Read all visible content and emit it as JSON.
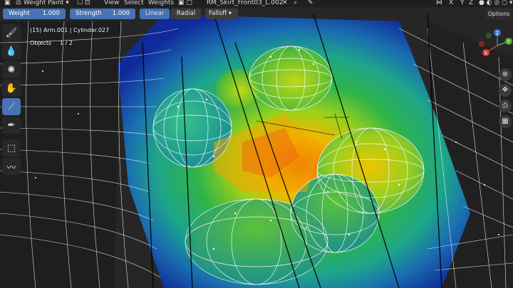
{
  "header": {
    "mode": "Weight Paint",
    "menu_view": "View",
    "menu_select": "Select",
    "menu_weights": "Weights",
    "object_name": "RM_Skirt_Front03_L.002"
  },
  "tool_settings": {
    "weight_label": "Weight",
    "weight_value": "1.000",
    "strength_label": "Strength",
    "strength_value": "1.000",
    "linear": "Linear",
    "radial": "Radial",
    "falloff": "Falloff",
    "options": "Options"
  },
  "viewport_info": {
    "object_line": "(15) Arm.001 | Cylinder.027",
    "objects_label": "Objects",
    "objects_count": "1 / 2"
  },
  "gizmo": {
    "z": "Z",
    "y": "Y",
    "x": "X"
  },
  "nav_axes": {
    "x": "X",
    "y": "Y",
    "z": "Z"
  },
  "colors": {
    "accent": "#4772b3",
    "header_bg": "#1f1f1f",
    "weight_high": "#f03a00",
    "weight_low": "#0a1a8c"
  }
}
